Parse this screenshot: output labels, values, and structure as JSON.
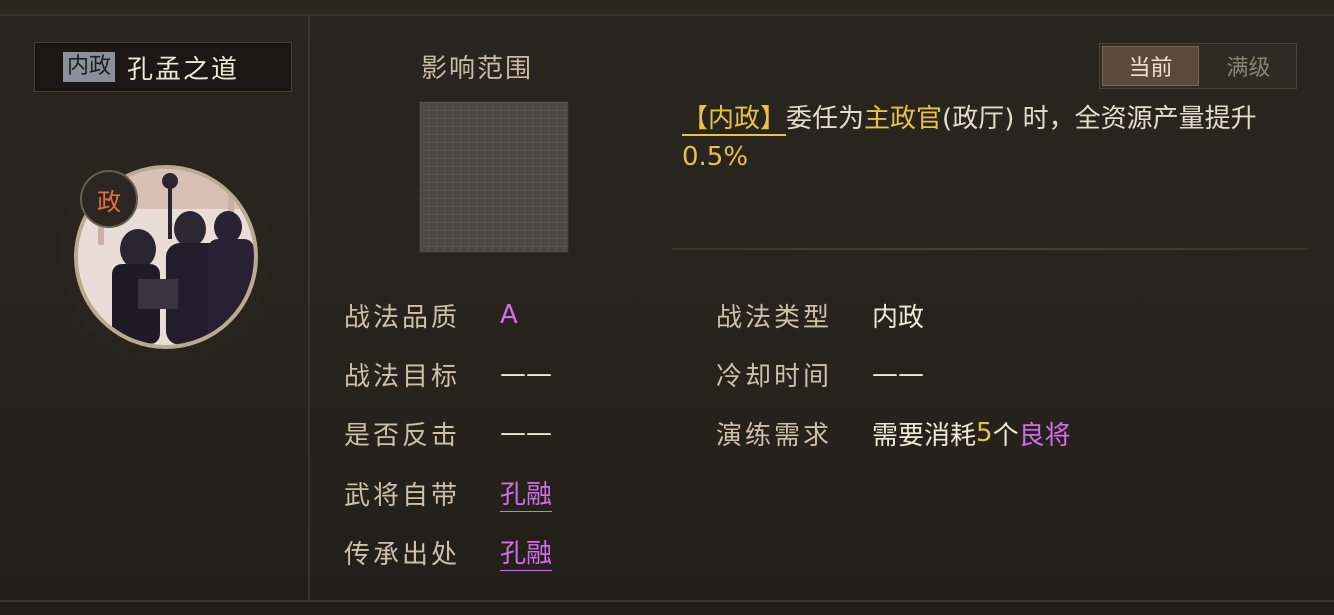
{
  "skill": {
    "type_tag": "内政",
    "name": "孔孟之道",
    "badge": "政"
  },
  "range": {
    "title": "影响范围"
  },
  "toggle": {
    "current": "当前",
    "max": "满级"
  },
  "description": {
    "tag": "【内政】",
    "part1": "委任为",
    "highlight1": "主政官",
    "part2": "(政厅) 时，全资源产量提升",
    "highlight2": "0.5%"
  },
  "stats_left": [
    {
      "label": "战法品质",
      "value": "A"
    },
    {
      "label": "战法目标",
      "value": "——"
    },
    {
      "label": "是否反击",
      "value": "——"
    },
    {
      "label": "武将自带",
      "value": "孔融"
    },
    {
      "label": "传承出处",
      "value": "孔融"
    }
  ],
  "stats_right": [
    {
      "label": "战法类型",
      "value": "内政"
    },
    {
      "label": "冷却时间",
      "value": "——"
    },
    {
      "label": "演练需求",
      "value_prefix": "需要消耗",
      "value_count": "5",
      "value_mid": "个",
      "value_item": "良将"
    }
  ],
  "colors": {
    "accent_gold": "#e8c04a",
    "quality_purple": "#d16ee8",
    "background": "#27221c"
  }
}
